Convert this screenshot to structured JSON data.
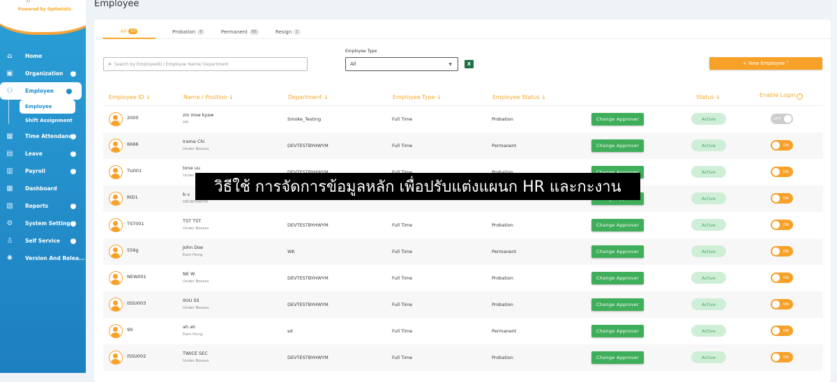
{
  "sidebar": {
    "powered": "Powered by Optimistic",
    "items": [
      {
        "label": "Home",
        "icon": "home-icon",
        "chev": false
      },
      {
        "label": "Organization",
        "icon": "organization-icon",
        "chev": true
      },
      {
        "label": "Employee",
        "icon": "employee-icon",
        "chev": true,
        "active": true
      },
      {
        "label": "Time Attendance",
        "icon": "calendar-clock-icon",
        "chev": true
      },
      {
        "label": "Leave",
        "icon": "leave-icon",
        "chev": true
      },
      {
        "label": "Payroll",
        "icon": "payroll-icon",
        "chev": true
      },
      {
        "label": "Dashboard",
        "icon": "dashboard-icon",
        "chev": false
      },
      {
        "label": "Reports",
        "icon": "reports-icon",
        "chev": true
      },
      {
        "label": "System Setting",
        "icon": "gear-icon",
        "chev": true
      },
      {
        "label": "Self Service",
        "icon": "user-icon",
        "chev": true
      },
      {
        "label": "Version And Relea...",
        "icon": "version-icon",
        "chev": false
      }
    ],
    "subitems": [
      "Employee",
      "Shift Assignment"
    ]
  },
  "page": {
    "title": "Employee"
  },
  "tabs": [
    {
      "label": "All",
      "count": "93"
    },
    {
      "label": "Probation",
      "count": "6"
    },
    {
      "label": "Permanent",
      "count": "85"
    },
    {
      "label": "Resign",
      "count": "1"
    }
  ],
  "filters": {
    "search_placeholder": "Search by EmployeeID / Employee Name/ Department",
    "type_label": "Employee Type",
    "type_value": "All",
    "excel": "X"
  },
  "new_employee": "+   New Employee   ˅",
  "columns": [
    "Employee ID ↓",
    "Name / Position ↓",
    "Department ↓",
    "Employee Type ↓",
    "Employee Status ↓",
    "Status ↓",
    "Enable Login"
  ],
  "approve_label": "Change Approver",
  "rows": [
    {
      "id": "2000",
      "name": "zin moe kyaw",
      "pos": "HH",
      "dept": "Smoke_Testing",
      "type": "Full Time",
      "estatus": "Probation",
      "status": "Active",
      "login": "OFF"
    },
    {
      "id": "6666",
      "name": "Irama Chi",
      "pos": "Under Bosses",
      "dept": "DEVTESTBYHWYM",
      "type": "Full Time",
      "estatus": "Permanent",
      "status": "Active",
      "login": "ON"
    },
    {
      "id": "TU001",
      "name": "tone uu",
      "pos": "Under Bosses",
      "dept": "DEVTESTBYHWYM",
      "type": "Full Time",
      "estatus": "Probation",
      "status": "Active",
      "login": "ON"
    },
    {
      "id": "RID1",
      "name": "b v",
      "pos": "DEVBYHWYM",
      "dept": "",
      "type": "",
      "estatus": "",
      "status": "Active",
      "login": "ON"
    },
    {
      "id": "TST001",
      "name": "TST TST",
      "pos": "Under Bosses",
      "dept": "DEVTESTBYHWYM",
      "type": "Full Time",
      "estatus": "Probation",
      "status": "Active",
      "login": "ON"
    },
    {
      "id": "556g",
      "name": "John Doe",
      "pos": "Eam Hong",
      "dept": "WK",
      "type": "Full Time",
      "estatus": "Permanent",
      "status": "Active",
      "login": "ON"
    },
    {
      "id": "NEW001",
      "name": "NE W",
      "pos": "Under Bosses",
      "dept": "DEVTESTBYHWYM",
      "type": "Full Time",
      "estatus": "Probation",
      "status": "Active",
      "login": "ON"
    },
    {
      "id": "ISSU003",
      "name": "IIUU SS",
      "pos": "Under Bosses",
      "dept": "DEVTESTBYHWYM",
      "type": "Full Time",
      "estatus": "Probation",
      "status": "Active",
      "login": "ON"
    },
    {
      "id": "99",
      "name": "ah ah",
      "pos": "Eam Hong",
      "dept": "sd",
      "type": "Full Time",
      "estatus": "Permanent",
      "status": "Active",
      "login": "ON"
    },
    {
      "id": "ISSU002",
      "name": "TWICE SEC",
      "pos": "Under Bosses",
      "dept": "DEVTESTBYHWYM",
      "type": "Full Time",
      "estatus": "Probation",
      "status": "Active",
      "login": "ON"
    }
  ],
  "overlay": "วิธีใช้ การจัดการข้อมูลหลัก เพื่อปรับแต่งแผนก HR และกะงาน",
  "colors": {
    "accent": "#f7a128",
    "green": "#3fae5a",
    "sidebar": "#1d8ccc"
  }
}
